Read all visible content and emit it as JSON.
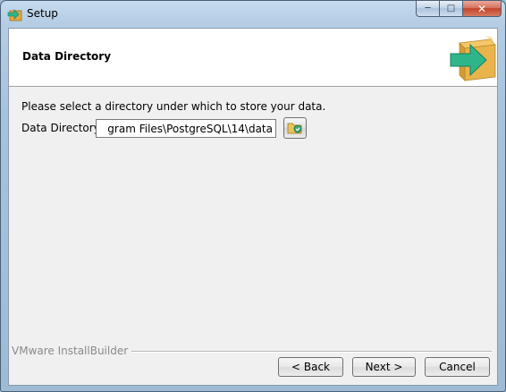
{
  "window": {
    "title": "Setup",
    "controls": {
      "minimize": "─",
      "maximize": "□",
      "close": "✕"
    }
  },
  "header": {
    "title": "Data Directory",
    "graphic": "box-arrow-icon"
  },
  "content": {
    "instruction": "Please select a directory under which to store your data.",
    "data_directory_label": "Data Directory",
    "data_directory_value": "gram Files\\PostgreSQL\\14\\data",
    "browse_icon": "folder-icon"
  },
  "footer": {
    "brand": "VMware InstallBuilder",
    "back_label": "< Back",
    "next_label": "Next >",
    "cancel_label": "Cancel"
  },
  "colors": {
    "arrow": "#2fb58a",
    "box": "#e9b44c"
  }
}
